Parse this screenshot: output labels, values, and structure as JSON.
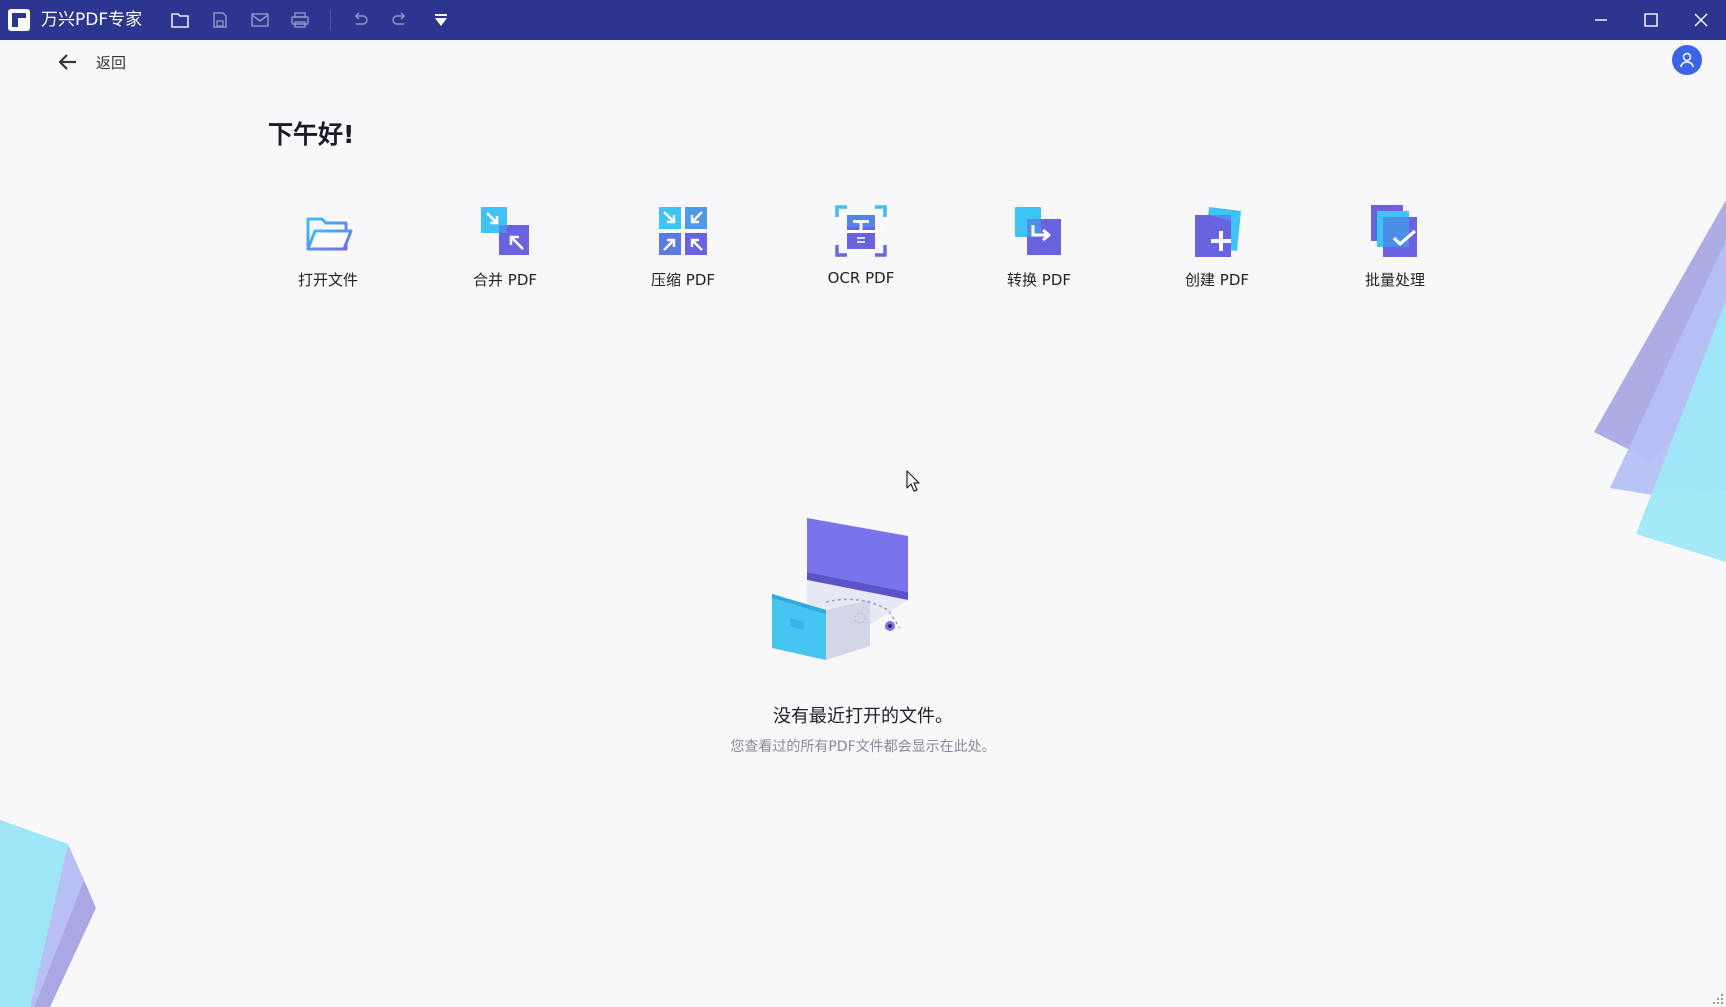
{
  "titlebar": {
    "app_title": "万兴PDF专家",
    "icons": [
      "app-logo-icon",
      "open-folder-icon",
      "save-icon",
      "mail-icon",
      "print-icon",
      "undo-icon",
      "redo-icon",
      "quick-access-dropdown-icon"
    ],
    "window_controls": [
      "minimize-icon",
      "maximize-icon",
      "close-icon"
    ],
    "background": "#2c3590"
  },
  "header": {
    "back_label": "返回"
  },
  "greeting": "下午好!",
  "tools": [
    {
      "label": "打开文件",
      "icon": "open-file-icon"
    },
    {
      "label": "合并 PDF",
      "icon": "merge-pdf-icon"
    },
    {
      "label": "压缩 PDF",
      "icon": "compress-pdf-icon"
    },
    {
      "label": "OCR PDF",
      "icon": "ocr-pdf-icon"
    },
    {
      "label": "转换 PDF",
      "icon": "convert-pdf-icon"
    },
    {
      "label": "创建 PDF",
      "icon": "create-pdf-icon"
    },
    {
      "label": "批量处理",
      "icon": "batch-process-icon"
    }
  ],
  "empty_state": {
    "title": "没有最近打开的文件。",
    "subtitle": "您查看过的所有PDF文件都会显示在此处。"
  },
  "colors": {
    "accent": "#3d63e8",
    "purple": "#6b63e0",
    "cyan": "#37c3f5"
  }
}
